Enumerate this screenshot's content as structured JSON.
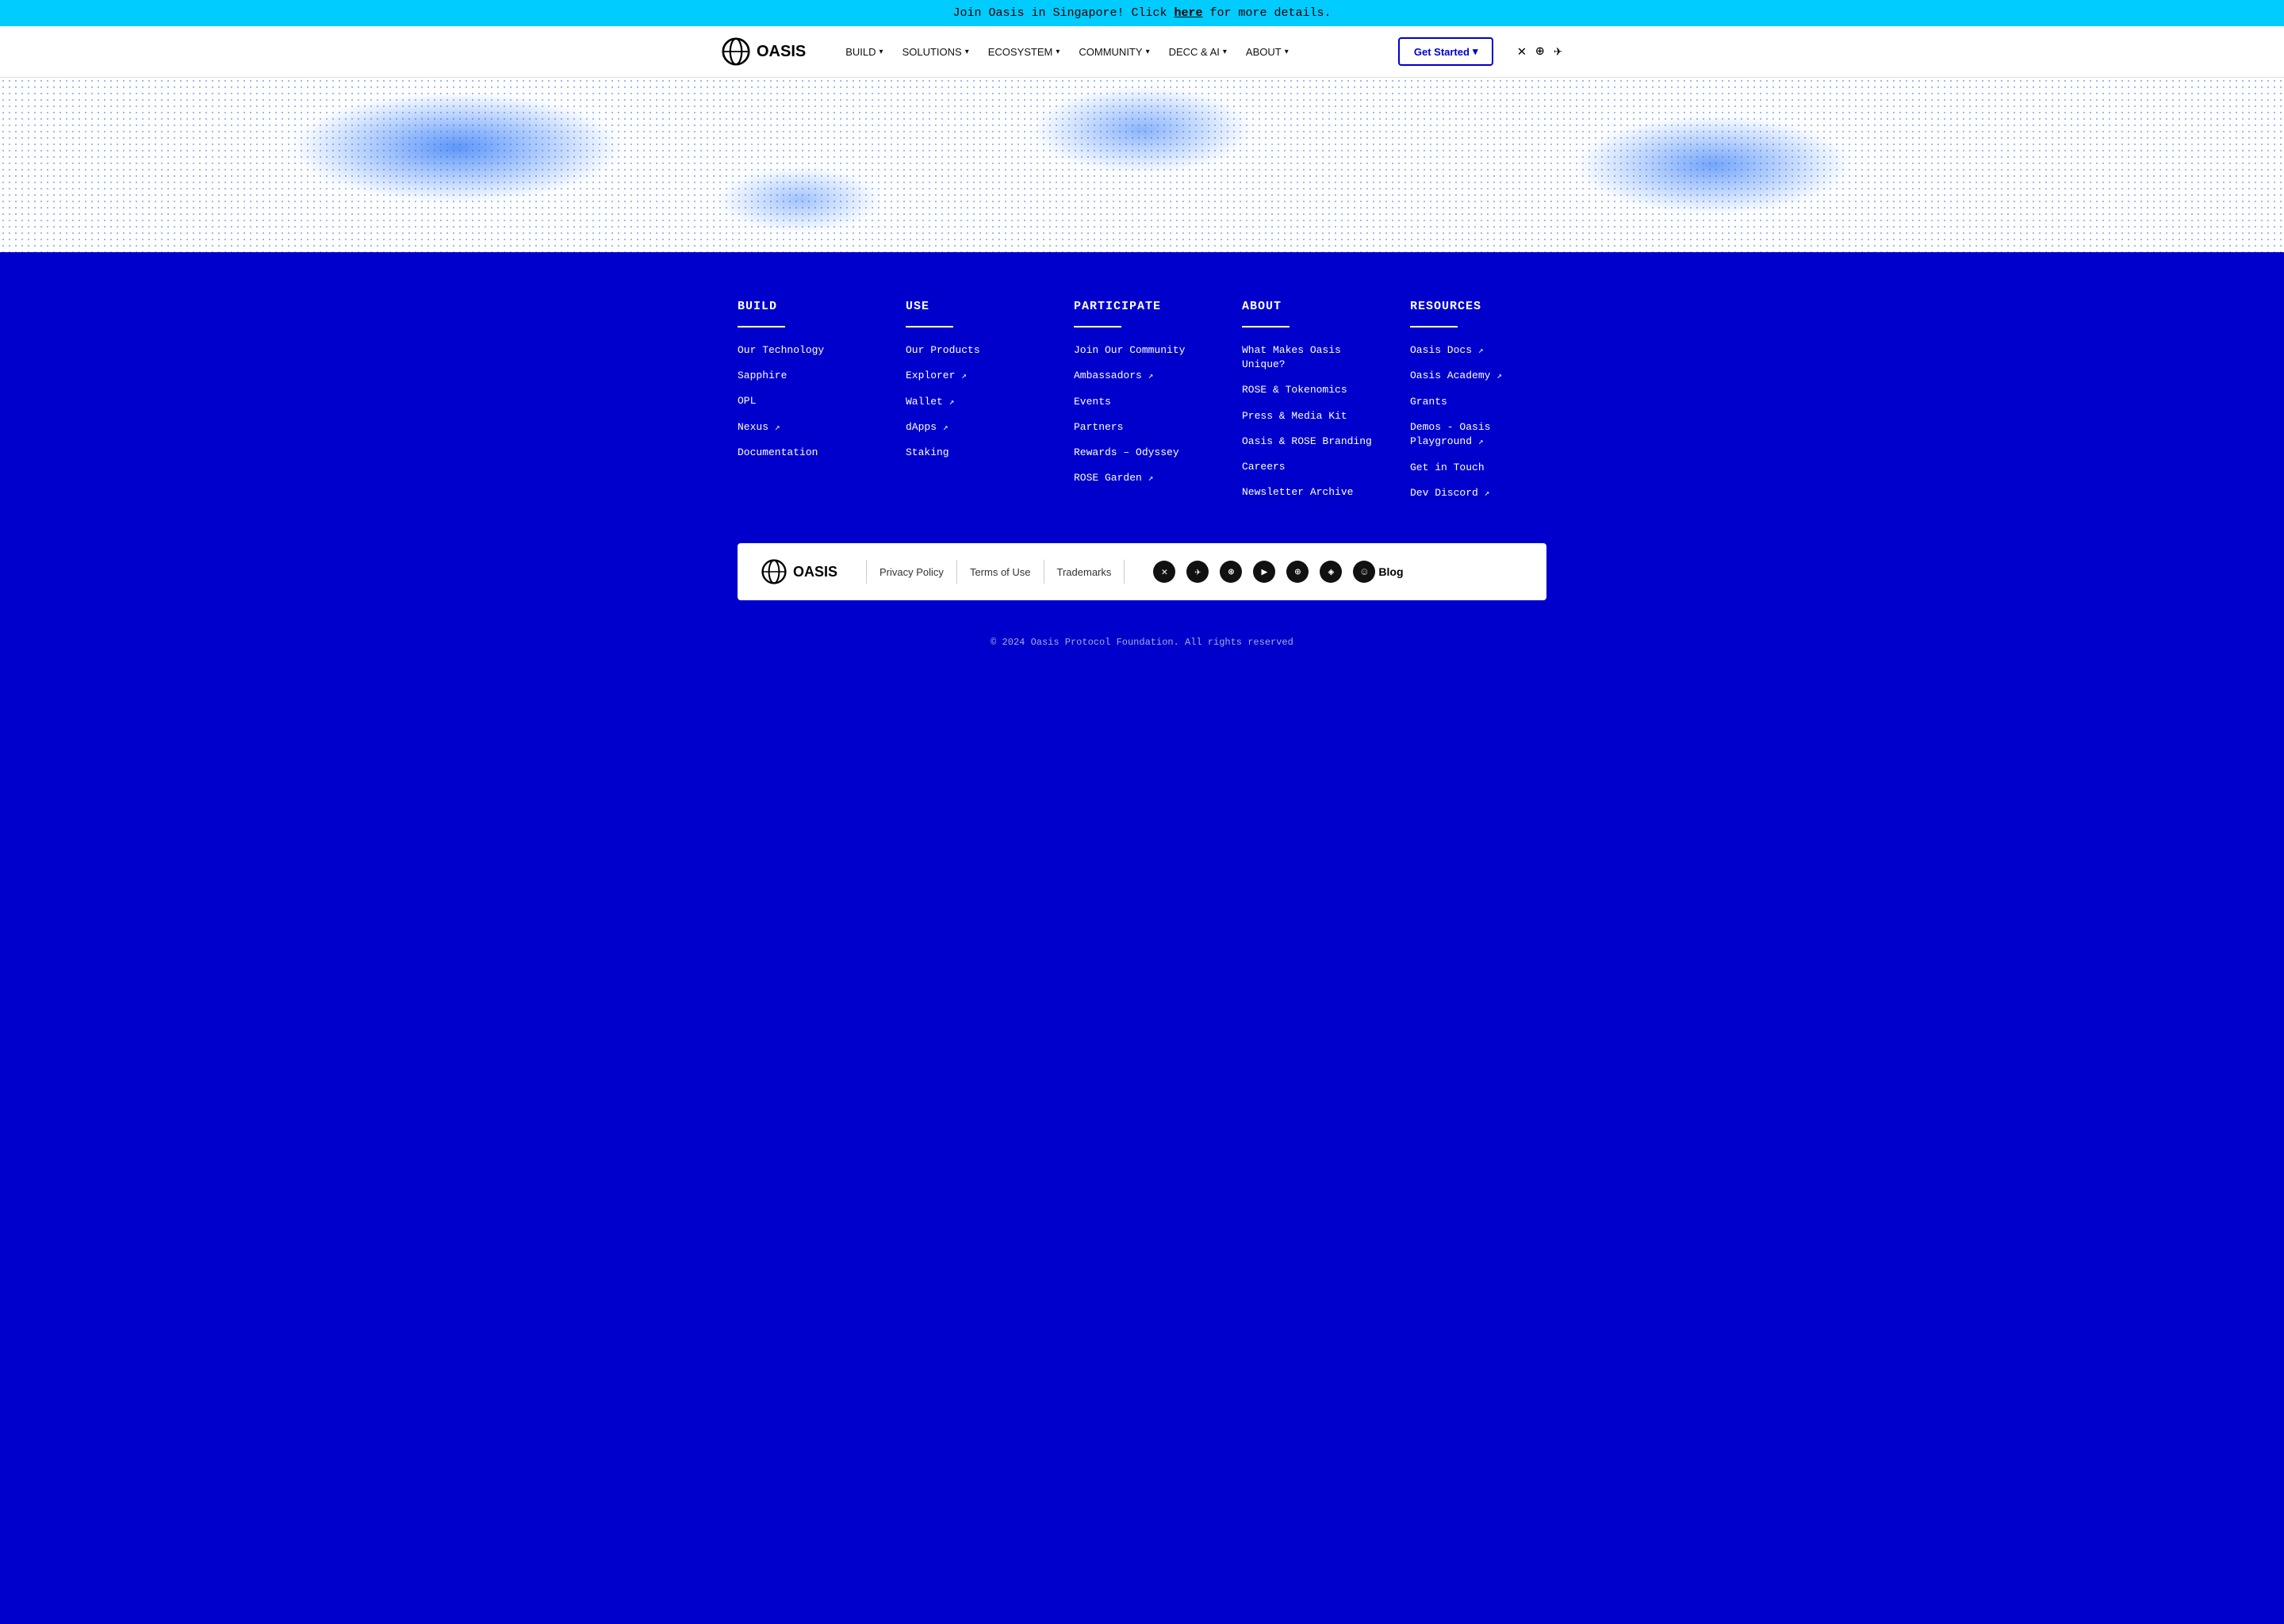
{
  "announcement": {
    "text": "Join Oasis in Singapore! Click ",
    "link_text": "here",
    "text_after": " for more details."
  },
  "nav": {
    "logo_text": "OASIS",
    "links": [
      {
        "label": "BUILD",
        "has_dropdown": true
      },
      {
        "label": "SOLUTIONS",
        "has_dropdown": true
      },
      {
        "label": "ECOSYSTEM",
        "has_dropdown": true
      },
      {
        "label": "COMMUNITY",
        "has_dropdown": true
      },
      {
        "label": "DECC & AI",
        "has_dropdown": true
      },
      {
        "label": "ABOUT",
        "has_dropdown": true
      }
    ],
    "get_started": "Get Started"
  },
  "footer": {
    "columns": [
      {
        "title": "BUILD",
        "links": [
          {
            "label": "Our Technology",
            "external": false
          },
          {
            "label": "Sapphire",
            "external": false
          },
          {
            "label": "OPL",
            "external": false
          },
          {
            "label": "Nexus",
            "external": true
          },
          {
            "label": "Documentation",
            "external": false
          }
        ]
      },
      {
        "title": "USE",
        "links": [
          {
            "label": "Our Products",
            "external": false
          },
          {
            "label": "Explorer",
            "external": true
          },
          {
            "label": "Wallet",
            "external": true
          },
          {
            "label": "dApps",
            "external": true
          },
          {
            "label": "Staking",
            "external": false
          }
        ]
      },
      {
        "title": "PARTICIPATE",
        "links": [
          {
            "label": "Join Our Community",
            "external": false
          },
          {
            "label": "Ambassadors",
            "external": true
          },
          {
            "label": "Events",
            "external": false
          },
          {
            "label": "Partners",
            "external": false
          },
          {
            "label": "Rewards – Odyssey",
            "external": false
          },
          {
            "label": "ROSE Garden",
            "external": true
          }
        ]
      },
      {
        "title": "ABOUT",
        "links": [
          {
            "label": "What Makes Oasis Unique?",
            "external": false
          },
          {
            "label": "ROSE & Tokenomics",
            "external": false
          },
          {
            "label": "Press & Media Kit",
            "external": false
          },
          {
            "label": "Oasis & ROSE Branding",
            "external": false
          },
          {
            "label": "Careers",
            "external": false
          },
          {
            "label": "Newsletter Archive",
            "external": false
          }
        ]
      },
      {
        "title": "RESOURCES",
        "links": [
          {
            "label": "Oasis Docs",
            "external": true
          },
          {
            "label": "Oasis Academy",
            "external": true
          },
          {
            "label": "Grants",
            "external": false
          },
          {
            "label": "Demos - Oasis Playground",
            "external": true
          },
          {
            "label": "Get in Touch",
            "external": false
          },
          {
            "label": "Dev Discord",
            "external": true
          }
        ]
      }
    ],
    "bottom_links": [
      {
        "label": "Privacy Policy"
      },
      {
        "label": "Terms of Use"
      },
      {
        "label": "Trademarks"
      }
    ],
    "blog_label": "Blog",
    "copyright": "© 2024 Oasis Protocol Foundation. All rights reserved"
  }
}
